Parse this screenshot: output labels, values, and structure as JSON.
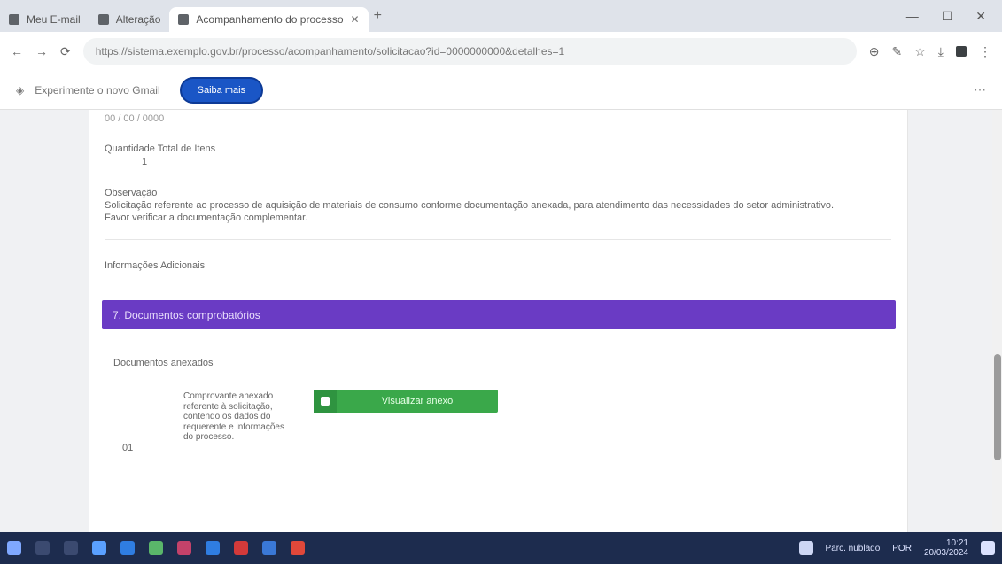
{
  "browser": {
    "tabs": [
      {
        "label": "Meu E-mail",
        "active": false
      },
      {
        "label": "Alteração",
        "active": false
      },
      {
        "label": "Acompanhamento do processo",
        "active": true
      }
    ],
    "new_tab": "+",
    "url": "https://sistema.exemplo.gov.br/processo/acompanhamento/solicitacao?id=0000000000&detalhes=1",
    "bookmark_text": "Experimente o novo Gmail",
    "bookmark_button": "Saiba mais"
  },
  "form": {
    "top_value": "00 / 00 / 0000",
    "field1_label": "Quantidade Total de Itens",
    "field1_value": "1",
    "obs_label": "Observação",
    "obs_text": "Solicitação referente ao processo de aquisição de materiais de consumo conforme documentação anexada, para atendimento das necessidades do setor administrativo.",
    "obs_text2": "Favor verificar a documentação complementar.",
    "field3_label": "Informações Adicionais",
    "section_title": "7. Documentos comprobatórios",
    "docs_label": "Documentos anexados",
    "row_number": "01",
    "doc_text": "Comprovante anexado referente à solicitação, contendo os dados do requerente e informações do processo.",
    "download_label": "Visualizar anexo"
  },
  "taskbar": {
    "lang": "POR",
    "time": "10:21",
    "date": "20/03/2024",
    "weather": "Parc. nublado"
  },
  "colors": {
    "section_purple": "#6a3bc4",
    "action_green": "#3aa84a",
    "bookmark_blue": "#1a56c6",
    "taskbar": "#1d2c4e"
  }
}
